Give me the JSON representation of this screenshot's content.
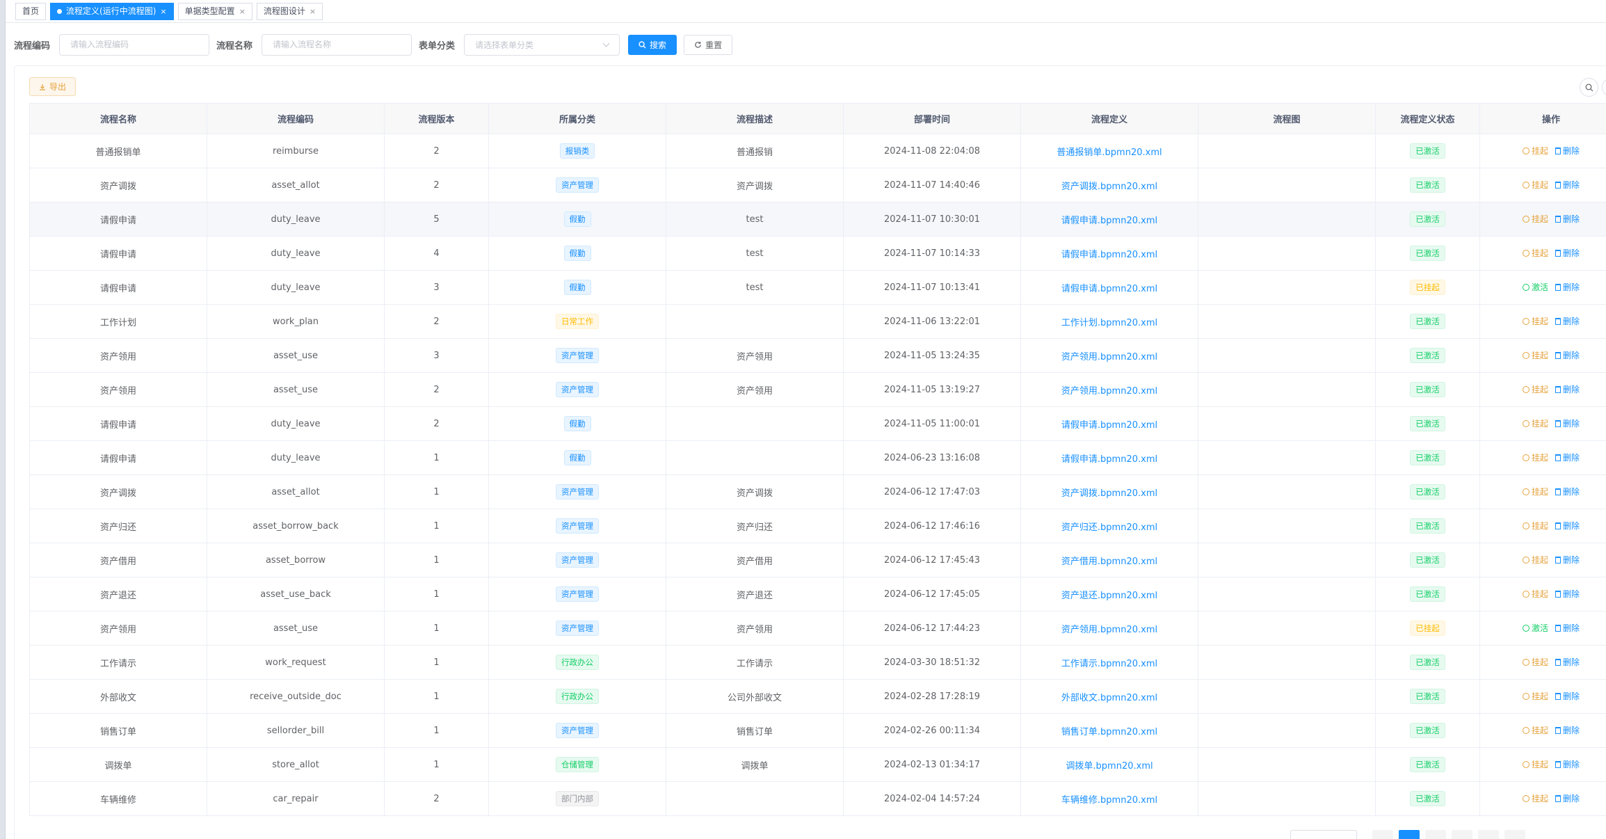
{
  "tabs": [
    {
      "label": "首页",
      "closable": false,
      "active": false
    },
    {
      "label": "流程定义(运行中流程图)",
      "closable": true,
      "active": true
    },
    {
      "label": "单据类型配置",
      "closable": true,
      "active": false
    },
    {
      "label": "流程图设计",
      "closable": true,
      "active": false
    }
  ],
  "search": {
    "code_label": "流程编码",
    "code_placeholder": "请输入流程编码",
    "name_label": "流程名称",
    "name_placeholder": "请输入流程名称",
    "category_label": "表单分类",
    "category_placeholder": "请选择表单分类",
    "search_button": "搜索",
    "reset_button": "重置"
  },
  "toolbar": {
    "export_label": "导出"
  },
  "table": {
    "headers": [
      "流程名称",
      "流程编码",
      "流程版本",
      "所属分类",
      "流程描述",
      "部署时间",
      "流程定义",
      "流程图",
      "流程定义状态",
      "操作"
    ],
    "rows": [
      {
        "name": "普通报销单",
        "code": "reimburse",
        "version": "2",
        "category": "报销类",
        "cat_color": "blue",
        "desc": "普通报销",
        "time": "2024-11-08 22:04:08",
        "file": "普通报销单.bpmn20.xml",
        "status": "已激活",
        "status_color": "green",
        "op1": "挂起",
        "op2": "删除"
      },
      {
        "name": "资产调拨",
        "code": "asset_allot",
        "version": "2",
        "category": "资产管理",
        "cat_color": "blue",
        "desc": "资产调拨",
        "time": "2024-11-07 14:40:46",
        "file": "资产调拨.bpmn20.xml",
        "status": "已激活",
        "status_color": "green",
        "op1": "挂起",
        "op2": "删除"
      },
      {
        "name": "请假申请",
        "code": "duty_leave",
        "version": "5",
        "category": "假勤",
        "cat_color": "blue",
        "desc": "test",
        "time": "2024-11-07 10:30:01",
        "file": "请假申请.bpmn20.xml",
        "status": "已激活",
        "status_color": "green",
        "op1": "挂起",
        "op2": "删除"
      },
      {
        "name": "请假申请",
        "code": "duty_leave",
        "version": "4",
        "category": "假勤",
        "cat_color": "blue",
        "desc": "test",
        "time": "2024-11-07 10:14:33",
        "file": "请假申请.bpmn20.xml",
        "status": "已激活",
        "status_color": "green",
        "op1": "挂起",
        "op2": "删除"
      },
      {
        "name": "请假申请",
        "code": "duty_leave",
        "version": "3",
        "category": "假勤",
        "cat_color": "blue",
        "desc": "test",
        "time": "2024-11-07 10:13:41",
        "file": "请假申请.bpmn20.xml",
        "status": "已挂起",
        "status_color": "orange",
        "op1": "激活",
        "op2": "删除"
      },
      {
        "name": "工作计划",
        "code": "work_plan",
        "version": "2",
        "category": "日常工作",
        "cat_color": "orange",
        "desc": "",
        "time": "2024-11-06 13:22:01",
        "file": "工作计划.bpmn20.xml",
        "status": "已激活",
        "status_color": "green",
        "op1": "挂起",
        "op2": "删除"
      },
      {
        "name": "资产领用",
        "code": "asset_use",
        "version": "3",
        "category": "资产管理",
        "cat_color": "blue",
        "desc": "资产领用",
        "time": "2024-11-05 13:24:35",
        "file": "资产领用.bpmn20.xml",
        "status": "已激活",
        "status_color": "green",
        "op1": "挂起",
        "op2": "删除"
      },
      {
        "name": "资产领用",
        "code": "asset_use",
        "version": "2",
        "category": "资产管理",
        "cat_color": "blue",
        "desc": "资产领用",
        "time": "2024-11-05 13:19:27",
        "file": "资产领用.bpmn20.xml",
        "status": "已激活",
        "status_color": "green",
        "op1": "挂起",
        "op2": "删除"
      },
      {
        "name": "请假申请",
        "code": "duty_leave",
        "version": "2",
        "category": "假勤",
        "cat_color": "blue",
        "desc": "",
        "time": "2024-11-05 11:00:01",
        "file": "请假申请.bpmn20.xml",
        "status": "已激活",
        "status_color": "green",
        "op1": "挂起",
        "op2": "删除"
      },
      {
        "name": "请假申请",
        "code": "duty_leave",
        "version": "1",
        "category": "假勤",
        "cat_color": "blue",
        "desc": "",
        "time": "2024-06-23 13:16:08",
        "file": "请假申请.bpmn20.xml",
        "status": "已激活",
        "status_color": "green",
        "op1": "挂起",
        "op2": "删除"
      },
      {
        "name": "资产调拨",
        "code": "asset_allot",
        "version": "1",
        "category": "资产管理",
        "cat_color": "blue",
        "desc": "资产调拨",
        "time": "2024-06-12 17:47:03",
        "file": "资产调拨.bpmn20.xml",
        "status": "已激活",
        "status_color": "green",
        "op1": "挂起",
        "op2": "删除"
      },
      {
        "name": "资产归还",
        "code": "asset_borrow_back",
        "version": "1",
        "category": "资产管理",
        "cat_color": "blue",
        "desc": "资产归还",
        "time": "2024-06-12 17:46:16",
        "file": "资产归还.bpmn20.xml",
        "status": "已激活",
        "status_color": "green",
        "op1": "挂起",
        "op2": "删除"
      },
      {
        "name": "资产借用",
        "code": "asset_borrow",
        "version": "1",
        "category": "资产管理",
        "cat_color": "blue",
        "desc": "资产借用",
        "time": "2024-06-12 17:45:43",
        "file": "资产借用.bpmn20.xml",
        "status": "已激活",
        "status_color": "green",
        "op1": "挂起",
        "op2": "删除"
      },
      {
        "name": "资产退还",
        "code": "asset_use_back",
        "version": "1",
        "category": "资产管理",
        "cat_color": "blue",
        "desc": "资产退还",
        "time": "2024-06-12 17:45:05",
        "file": "资产退还.bpmn20.xml",
        "status": "已激活",
        "status_color": "green",
        "op1": "挂起",
        "op2": "删除"
      },
      {
        "name": "资产领用",
        "code": "asset_use",
        "version": "1",
        "category": "资产管理",
        "cat_color": "blue",
        "desc": "资产领用",
        "time": "2024-06-12 17:44:23",
        "file": "资产领用.bpmn20.xml",
        "status": "已挂起",
        "status_color": "orange",
        "op1": "激活",
        "op2": "删除"
      },
      {
        "name": "工作请示",
        "code": "work_request",
        "version": "1",
        "category": "行政办公",
        "cat_color": "green",
        "desc": "工作请示",
        "time": "2024-03-30 18:51:32",
        "file": "工作请示.bpmn20.xml",
        "status": "已激活",
        "status_color": "green",
        "op1": "挂起",
        "op2": "删除"
      },
      {
        "name": "外部收文",
        "code": "receive_outside_doc",
        "version": "1",
        "category": "行政办公",
        "cat_color": "green",
        "desc": "公司外部收文",
        "time": "2024-02-28 17:28:19",
        "file": "外部收文.bpmn20.xml",
        "status": "已激活",
        "status_color": "green",
        "op1": "挂起",
        "op2": "删除"
      },
      {
        "name": "销售订单",
        "code": "sellorder_bill",
        "version": "1",
        "category": "资产管理",
        "cat_color": "blue",
        "desc": "销售订单",
        "time": "2024-02-26 00:11:34",
        "file": "销售订单.bpmn20.xml",
        "status": "已激活",
        "status_color": "green",
        "op1": "挂起",
        "op2": "删除"
      },
      {
        "name": "调拨单",
        "code": "store_allot",
        "version": "1",
        "category": "仓储管理",
        "cat_color": "green",
        "desc": "调拨单",
        "time": "2024-02-13 01:34:17",
        "file": "调拨单.bpmn20.xml",
        "status": "已激活",
        "status_color": "green",
        "op1": "挂起",
        "op2": "删除"
      },
      {
        "name": "车辆维修",
        "code": "car_repair",
        "version": "2",
        "category": "部门内部",
        "cat_color": "gray",
        "desc": "",
        "time": "2024-02-04 14:57:24",
        "file": "车辆维修.bpmn20.xml",
        "status": "已激活",
        "status_color": "green",
        "op1": "挂起",
        "op2": "删除"
      }
    ]
  },
  "colors": {
    "primary": "#1890ff",
    "warning": "#e6a23c",
    "success": "#13ce66",
    "header_bg": "#f8f8f9"
  },
  "icons": {
    "search": "search-icon",
    "reset": "refresh-icon",
    "export": "download-icon",
    "suspend": "pause-circle-icon",
    "activate": "play-circle-icon",
    "delete": "trash-icon"
  }
}
